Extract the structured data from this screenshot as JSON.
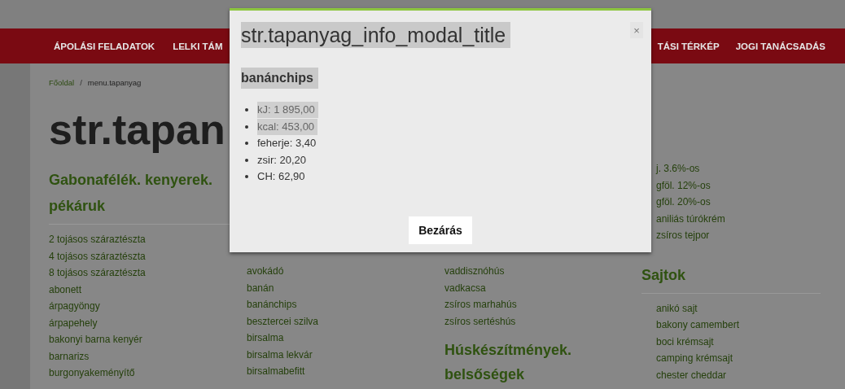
{
  "nav": {
    "left_items": [
      "ÁPOLÁSI FELADATOK",
      "LELKI TÁM"
    ],
    "right_items": [
      "TÁSI TÉRKÉP",
      "JOGI TANÁCSADÁS"
    ]
  },
  "breadcrumb": {
    "home": "Főoldal",
    "separator": "/",
    "current": "menu.tapanyag"
  },
  "page_title": "str.tapan",
  "columns": [
    {
      "headings": [
        {
          "title": "Gabonafélék. kenyerek. pékáruk",
          "items": [
            "2 tojásos száraztészta",
            "4 tojásos száraztészta",
            "8 tojásos száraztészta",
            "abonett",
            "árpagyöngy",
            "árpapehely",
            "bakonyi barna kenyér",
            "barnarizs",
            "burgonyakeményítő"
          ]
        }
      ]
    },
    {
      "headings": [
        {
          "items": [
            "avokádó",
            "banán",
            "banánchips",
            "besztercei szilva",
            "birsalma",
            "birsalma lekvár",
            "birsalmabefitt"
          ]
        }
      ]
    },
    {
      "headings": [
        {
          "items": [
            "vaddisznóhús",
            "vadkacsa",
            "zsíros marhahús",
            "zsíros sertéshús"
          ]
        },
        {
          "title": "Húskészítmények. belsőségek"
        }
      ]
    },
    {
      "headings": [
        {
          "items": [
            "j. 3.6%-os",
            "gföl. 12%-os",
            "gföl. 20%-os",
            "aniliás túrókrém",
            "zsíros tejpor"
          ]
        },
        {
          "title": "Sajtok",
          "items": [
            "anikó sajt",
            "bakony camembert",
            "boci krémsajt",
            "camping krémsajt",
            "chester cheddar"
          ]
        }
      ]
    }
  ],
  "modal": {
    "title": "str.tapanyag_info_modal_title",
    "close": "×",
    "food": "banánchips",
    "nutrients": [
      {
        "text": "kJ: 1 895,00",
        "highlighted": true
      },
      {
        "text": "kcal: 453,00",
        "highlighted": true
      },
      {
        "text": "feherje: 3,40",
        "highlighted": false
      },
      {
        "text": "zsir: 20,20",
        "highlighted": false
      },
      {
        "text": "CH: 62,90",
        "highlighted": false
      }
    ],
    "button": "Bezárás"
  }
}
